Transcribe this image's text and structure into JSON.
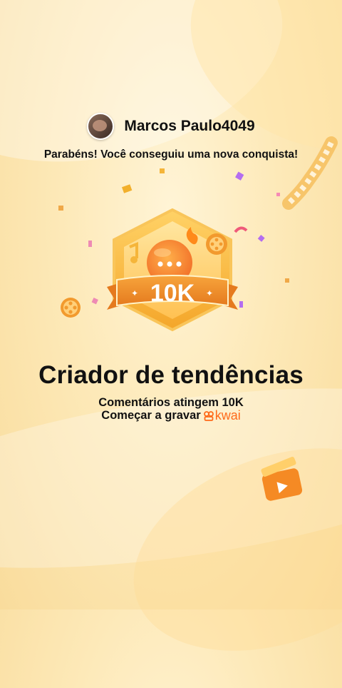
{
  "user": {
    "name": "Marcos Paulo4049"
  },
  "congrats": "Parabéns! Você conseguiu uma nova conquista!",
  "badge": {
    "label": "10K"
  },
  "achievement": {
    "title": "Criador de tendências",
    "subtitle": "Comentários atingem 10K",
    "record_text": "Começar a gravar",
    "brand": "kwai"
  },
  "colors": {
    "accent": "#ff6a1a",
    "badge_gold": "#f5b53a",
    "background": "#fde9b8"
  }
}
